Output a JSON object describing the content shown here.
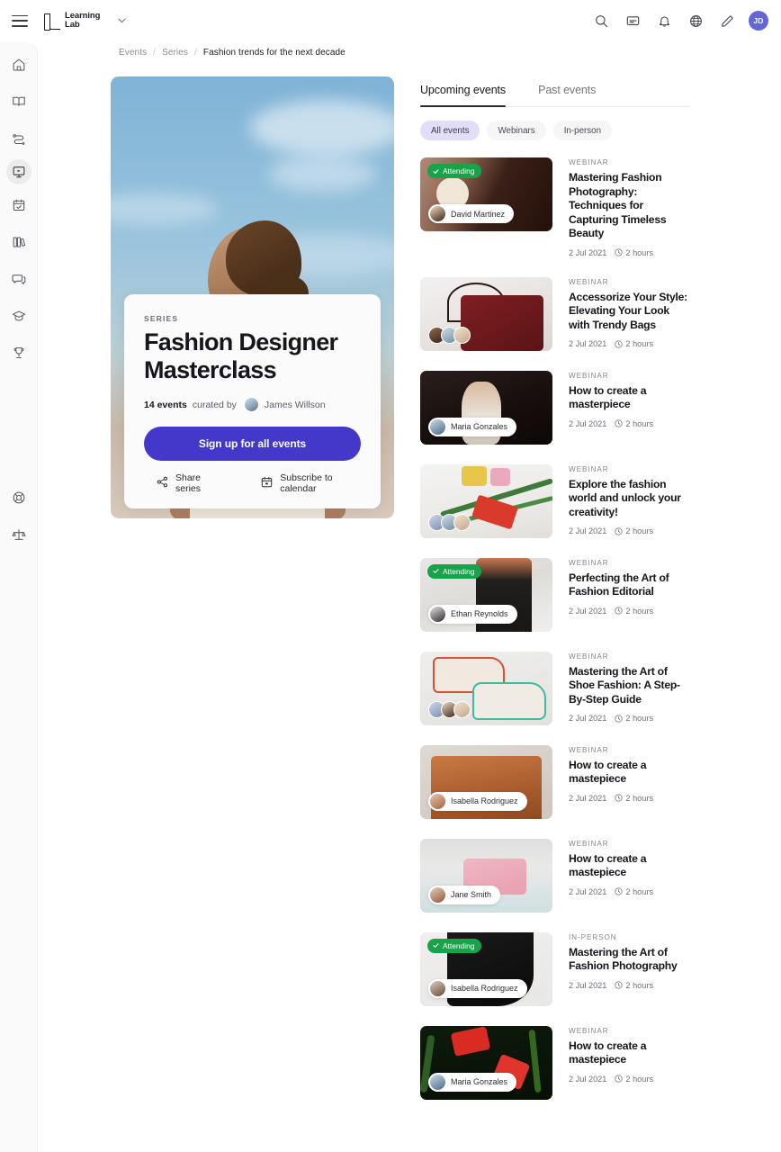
{
  "topbar": {
    "menu_icon": "hamburger-icon",
    "brand_line1": "Learning",
    "brand_line2": "Lab",
    "brand_chevron": "chevron-down-icon",
    "icons": [
      "search-icon",
      "chat-icon",
      "bell-icon",
      "globe-icon",
      "pencil-icon"
    ],
    "avatar_initials": "JD",
    "avatar_color": "#6366d6"
  },
  "sidebar": {
    "items": [
      {
        "name": "home",
        "label": "Home",
        "active": false
      },
      {
        "name": "book",
        "label": "Courses",
        "active": false
      },
      {
        "name": "path",
        "label": "Learning paths",
        "active": false
      },
      {
        "name": "events",
        "label": "Events",
        "active": true
      },
      {
        "name": "calendar",
        "label": "Calendar",
        "active": false
      },
      {
        "name": "library",
        "label": "Library",
        "active": false
      },
      {
        "name": "discussions",
        "label": "Discussions",
        "active": false
      },
      {
        "name": "graduation",
        "label": "Certifications",
        "active": false
      },
      {
        "name": "trophy",
        "label": "Achievements",
        "active": false
      }
    ],
    "bottom_items": [
      {
        "name": "help",
        "label": "Help"
      },
      {
        "name": "scales",
        "label": "Policies"
      }
    ]
  },
  "breadcrumb": {
    "items": [
      "Events",
      "Series"
    ],
    "separator": "/",
    "current": "Fashion trends for the next decade"
  },
  "series": {
    "kicker": "SERIES",
    "title": "Fashion Designer Masterclass",
    "event_count": "14 events",
    "curated_by": "curated by",
    "curator": "James Willson",
    "signup_label": "Sign up for all events",
    "signup_color": "#4338ca",
    "share_label": "Share series",
    "share_icon": "share-icon",
    "subscribe_label": "Subscribe to calendar",
    "subscribe_icon": "calendar-icon"
  },
  "events_panel": {
    "tabs": [
      {
        "label": "Upcoming events",
        "active": true
      },
      {
        "label": "Past events",
        "active": false
      }
    ],
    "filters": [
      {
        "label": "All events",
        "active": true
      },
      {
        "label": "Webinars",
        "active": false
      },
      {
        "label": "In-person",
        "active": false
      }
    ],
    "attending_label": "Attending",
    "attending_color": "#16a34a",
    "items": [
      {
        "kicker": "WEBINAR",
        "title": "Mastering Fashion Photography: Techniques for Capturing Timeless Beauty",
        "date": "2 Jul 2021",
        "duration": "2 hours",
        "attending": true,
        "presenter": "David Martinez",
        "avatars": []
      },
      {
        "kicker": "WEBINAR",
        "title": "Accessorize Your Style: Elevating Your Look with Trendy Bags",
        "date": "2 Jul 2021",
        "duration": "2 hours",
        "attending": false,
        "presenter": "",
        "avatars": [
          "av-a",
          "av-b",
          "av-c"
        ]
      },
      {
        "kicker": "WEBINAR",
        "title": "How to create a masterpiece",
        "date": "2 Jul 2021",
        "duration": "2 hours",
        "attending": false,
        "presenter": "Maria Gonzales",
        "avatars": []
      },
      {
        "kicker": "WEBINAR",
        "title": "Explore the fashion world and unlock your creativity!",
        "date": "2 Jul 2021",
        "duration": "2 hours",
        "attending": false,
        "presenter": "",
        "avatars": [
          "av-d",
          "av-b",
          "av-c"
        ]
      },
      {
        "kicker": "WEBINAR",
        "title": "Perfecting the Art of Fashion Editorial",
        "date": "2 Jul 2021",
        "duration": "2 hours",
        "attending": true,
        "presenter": "Ethan Reynolds",
        "avatars": []
      },
      {
        "kicker": "WEBINAR",
        "title": "Mastering the Art of Shoe Fashion: A Step-By-Step Guide",
        "date": "2 Jul 2021",
        "duration": "2 hours",
        "attending": false,
        "presenter": "",
        "avatars": [
          "av-d",
          "av-f",
          "av-c"
        ]
      },
      {
        "kicker": "WEBINAR",
        "title": "How to create a mastepiece",
        "date": "2 Jul 2021",
        "duration": "2 hours",
        "attending": false,
        "presenter": "Isabella Rodriguez",
        "avatars": []
      },
      {
        "kicker": "WEBINAR",
        "title": "How to create a mastepiece",
        "date": "2 Jul 2021",
        "duration": "2 hours",
        "attending": false,
        "presenter": "Jane Smith",
        "avatars": []
      },
      {
        "kicker": "IN-PERSON",
        "title": "Mastering the Art of Fashion Photography",
        "date": "2 Jul 2021",
        "duration": "2 hours",
        "attending": true,
        "presenter": "Isabella Rodriguez",
        "avatars": []
      },
      {
        "kicker": "WEBINAR",
        "title": "How to create a mastepiece",
        "date": "2 Jul 2021",
        "duration": "2 hours",
        "attending": false,
        "presenter": "Maria Gonzales",
        "avatars": []
      }
    ]
  }
}
